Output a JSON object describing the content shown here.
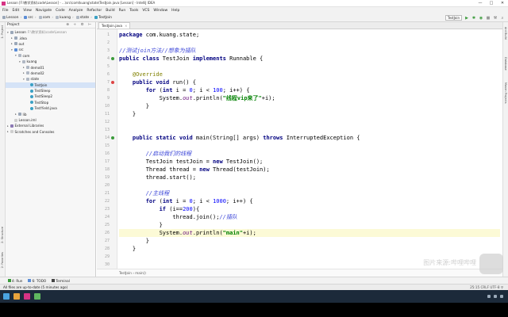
{
  "window": {
    "title": "Lesson [F:\\教学资料\\code\\Lesson] - ...\\src\\com\\kuang\\state\\TestJoin.java [Lesson] - IntelliJ IDEA",
    "controls": [
      "—",
      "□",
      "✕"
    ]
  },
  "menu": [
    "File",
    "Edit",
    "View",
    "Navigate",
    "Code",
    "Analyze",
    "Refactor",
    "Build",
    "Run",
    "Tools",
    "VCS",
    "Window",
    "Help"
  ],
  "breadcrumbs": [
    "Lesson",
    "src",
    "com",
    "kuang",
    "state",
    "TestJoin"
  ],
  "run_config": "TestJoin",
  "left_stripe": [
    "1: Project",
    "2: Structure",
    "2: Favorites"
  ],
  "right_stripe": [
    "Ant Build",
    "Database",
    "Maven Projects"
  ],
  "project": {
    "header": "Project",
    "tools": "⊕ ÷ ⚙ ⊢",
    "tree": [
      {
        "label": "Lesson",
        "note": "F:\\教学资料\\code\\Lesson",
        "indent": 0,
        "icon": "folder",
        "arrow": "▾"
      },
      {
        "label": ".idea",
        "note": "",
        "indent": 1,
        "icon": "folder",
        "arrow": "▸"
      },
      {
        "label": "out",
        "note": "",
        "indent": 1,
        "icon": "folder",
        "arrow": "▸"
      },
      {
        "label": "src",
        "note": "",
        "indent": 1,
        "icon": "folder-src",
        "arrow": "▾"
      },
      {
        "label": "com",
        "note": "",
        "indent": 2,
        "icon": "pkg",
        "arrow": "▾"
      },
      {
        "label": "kuang",
        "note": "",
        "indent": 3,
        "icon": "pkg",
        "arrow": "▾"
      },
      {
        "label": "demo01",
        "note": "",
        "indent": 4,
        "icon": "pkg",
        "arrow": "▸"
      },
      {
        "label": "demo02",
        "note": "",
        "indent": 4,
        "icon": "pkg",
        "arrow": "▸"
      },
      {
        "label": "state",
        "note": "",
        "indent": 4,
        "icon": "pkg",
        "arrow": "▾"
      },
      {
        "label": "TestJoin",
        "note": "",
        "indent": 5,
        "icon": "cls",
        "arrow": "",
        "selected": true
      },
      {
        "label": "TestSleep",
        "note": "",
        "indent": 5,
        "icon": "cls",
        "arrow": ""
      },
      {
        "label": "TestSleep2",
        "note": "",
        "indent": 5,
        "icon": "cls",
        "arrow": ""
      },
      {
        "label": "TestStop",
        "note": "",
        "indent": 5,
        "icon": "cls",
        "arrow": ""
      },
      {
        "label": "TestYield.java",
        "note": "",
        "indent": 5,
        "icon": "cls",
        "arrow": ""
      },
      {
        "label": "lib",
        "note": "",
        "indent": 2,
        "icon": "folder",
        "arrow": "▸"
      },
      {
        "label": "Lesson.iml",
        "note": "",
        "indent": 1,
        "icon": "file",
        "arrow": ""
      },
      {
        "label": "External Libraries",
        "note": "",
        "indent": 0,
        "icon": "lib",
        "arrow": "▸"
      },
      {
        "label": "Scratches and Consoles",
        "note": "",
        "indent": 0,
        "icon": "file",
        "arrow": "▸"
      }
    ]
  },
  "editor": {
    "tab": "TestJoin.java",
    "tab_close": "×",
    "breadcrumb": "TestJoin  ›  main()",
    "current_line": 26,
    "lines": [
      {
        "n": 1,
        "html": "<span class=\"kw\">package</span> com.kuang.state;"
      },
      {
        "n": 2,
        "html": ""
      },
      {
        "n": 3,
        "html": "<span class=\"cm\">//测试join方法//想象为插队</span>"
      },
      {
        "n": 4,
        "html": "<span class=\"kw\">public class</span> TestJoin <span class=\"kw\">implements</span> Runnable {"
      },
      {
        "n": 5,
        "html": ""
      },
      {
        "n": 6,
        "html": "    <span class=\"an\">@Override</span>"
      },
      {
        "n": 7,
        "html": "    <span class=\"kw\">public void</span> run() {"
      },
      {
        "n": 8,
        "html": "        <span class=\"kw\">for</span> (<span class=\"kw\">int</span> i = <span class=\"nm\">0</span>; i &lt; <span class=\"nm\">100</span>; i++) {"
      },
      {
        "n": 9,
        "html": "            System.<span class=\"fd\">out</span>.println(<span class=\"st\">\"线程vip来了\"</span>+i);"
      },
      {
        "n": 10,
        "html": "        }"
      },
      {
        "n": 11,
        "html": "    }"
      },
      {
        "n": 12,
        "html": ""
      },
      {
        "n": 13,
        "html": ""
      },
      {
        "n": 14,
        "html": "    <span class=\"kw\">public static void</span> main(String[] args) <span class=\"kw\">throws</span> InterruptedException {"
      },
      {
        "n": 15,
        "html": ""
      },
      {
        "n": 16,
        "html": "        <span class=\"cm\">//启动我们的线程</span>"
      },
      {
        "n": 17,
        "html": "        TestJoin testJoin = <span class=\"kw\">new</span> TestJoin();"
      },
      {
        "n": 18,
        "html": "        Thread thread = <span class=\"kw\">new</span> Thread(testJoin);"
      },
      {
        "n": 19,
        "html": "        thread.start();"
      },
      {
        "n": 20,
        "html": ""
      },
      {
        "n": 21,
        "html": "        <span class=\"cm\">//主线程</span>"
      },
      {
        "n": 22,
        "html": "        <span class=\"kw\">for</span> (<span class=\"kw\">int</span> i = <span class=\"nm\">0</span>; i &lt; <span class=\"nm\">1000</span>; i++) {"
      },
      {
        "n": 23,
        "html": "            <span class=\"kw\">if</span> (i==<span class=\"nm\">200</span>){"
      },
      {
        "n": 24,
        "html": "                thread.join();<span class=\"cm\">//插队</span>"
      },
      {
        "n": 25,
        "html": "            }"
      },
      {
        "n": 26,
        "html": "            System.<span class=\"fd\">out</span>.println(<span class=\"st\">\"main\"</span>+i);"
      },
      {
        "n": 27,
        "html": "        }"
      },
      {
        "n": 28,
        "html": "    }"
      },
      {
        "n": 29,
        "html": ""
      },
      {
        "n": 30,
        "html": ""
      }
    ]
  },
  "bottom_tabs": [
    "4: Run",
    "6: TODO",
    "Terminal"
  ],
  "status": {
    "message": "All files are up-to-date (5 minutes ago)",
    "right": "25:15  CRLF  UTF-8  ⚲"
  },
  "watermark": "图片来源:哔哩哔哩"
}
